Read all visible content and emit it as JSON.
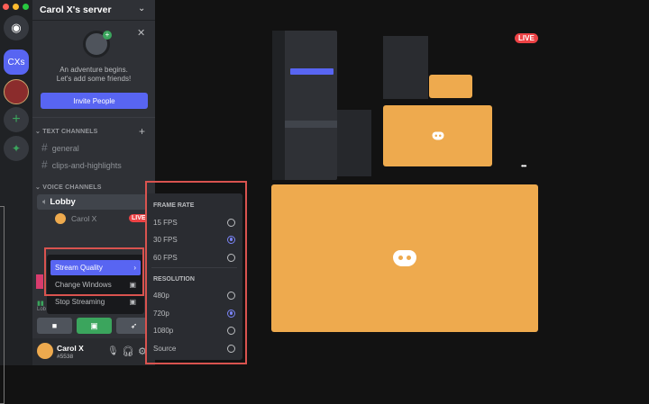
{
  "server": {
    "name": "Carol X's server",
    "initials": "CXs"
  },
  "welcome": {
    "line1": "An adventure begins.",
    "line2": "Let's add some friends!",
    "invite_label": "Invite People"
  },
  "text_channels": {
    "label": "TEXT CHANNELS",
    "items": [
      "general",
      "clips-and-highlights"
    ]
  },
  "voice_channels": {
    "label": "VOICE CHANNELS",
    "lobby": "Lobby",
    "member": "Carol X",
    "live": "LIVE"
  },
  "context_menu": {
    "items": [
      "Stream Quality",
      "Change Windows",
      "Stop Streaming"
    ]
  },
  "quality": {
    "frame_rate_label": "FRAME RATE",
    "frame_rates": [
      "15 FPS",
      "30 FPS",
      "60 FPS"
    ],
    "selected_frame_rate": "30 FPS",
    "resolution_label": "RESOLUTION",
    "resolutions": [
      "480p",
      "720p",
      "1080p",
      "Source"
    ],
    "selected_resolution": "720p"
  },
  "voice_status": "Lob",
  "user": {
    "name": "Carol X",
    "tag": "#5538"
  },
  "stream": {
    "live_badge": "LIVE",
    "more": "•••"
  },
  "colors": {
    "accent": "#5865f2",
    "live": "#ed4245",
    "green": "#3ba55d",
    "orange": "#eeaa4e"
  }
}
